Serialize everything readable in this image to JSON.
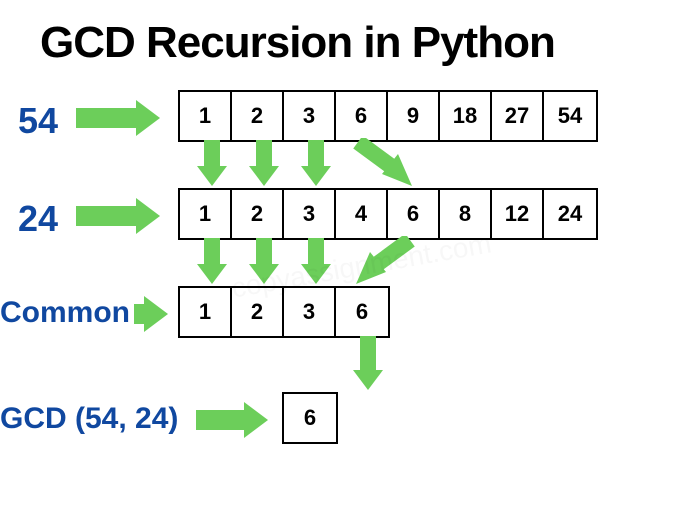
{
  "title": "GCD Recursion in Python",
  "labels": {
    "n54": "54",
    "n24": "24",
    "common": "Common",
    "gcd": "GCD (54, 24)"
  },
  "rows": {
    "factors54": [
      "1",
      "2",
      "3",
      "6",
      "9",
      "18",
      "27",
      "54"
    ],
    "factors24": [
      "1",
      "2",
      "3",
      "4",
      "6",
      "8",
      "12",
      "24"
    ],
    "common": [
      "1",
      "2",
      "3",
      "6"
    ],
    "gcd": [
      "6"
    ]
  },
  "watermark": "copyassignment.com"
}
